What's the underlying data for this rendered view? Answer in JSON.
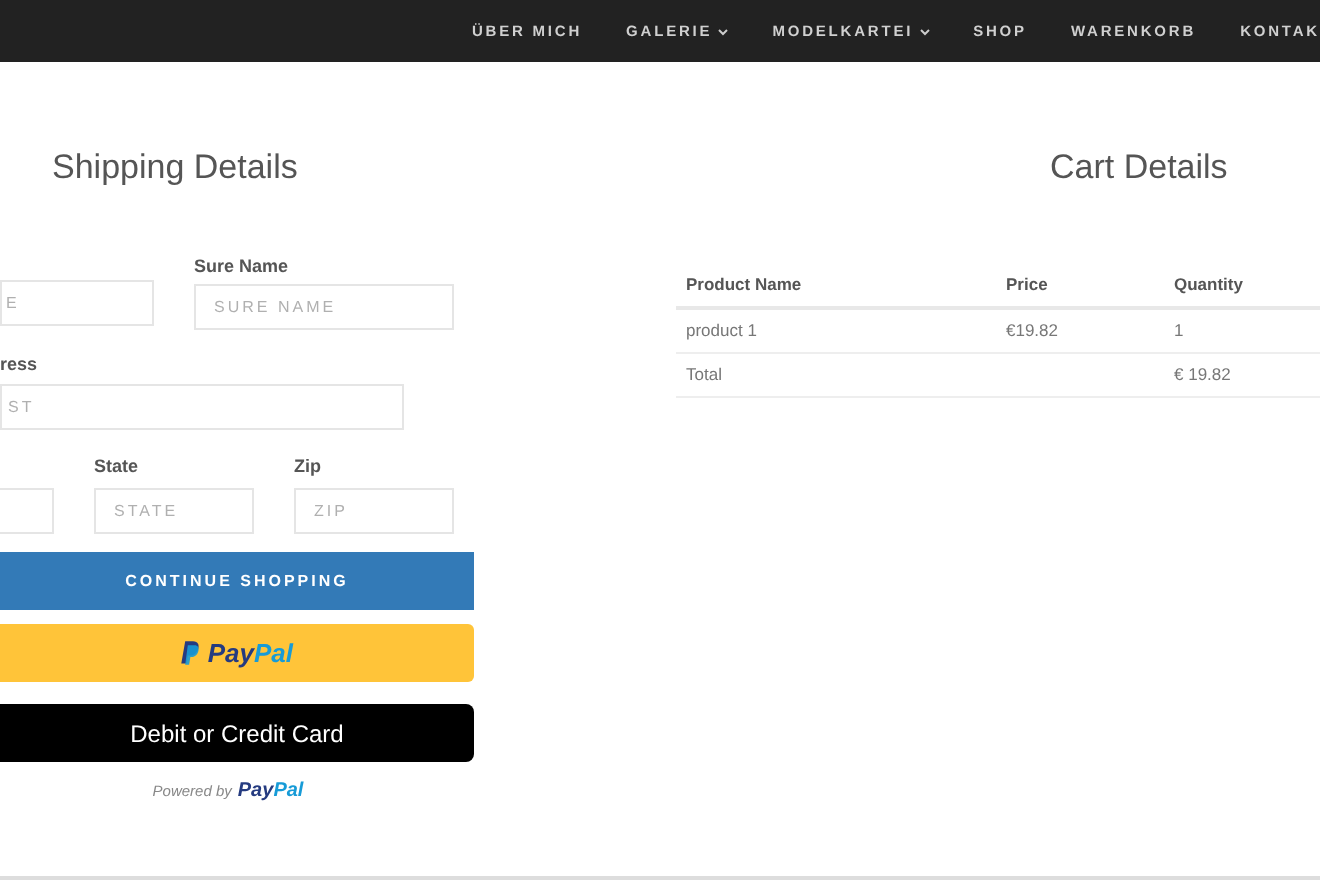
{
  "nav": {
    "items": [
      {
        "label": "ÜBER MICH",
        "dropdown": false
      },
      {
        "label": "GALERIE",
        "dropdown": true
      },
      {
        "label": "MODELKARTEI",
        "dropdown": true
      },
      {
        "label": "SHOP",
        "dropdown": false
      },
      {
        "label": "WARENKORB",
        "dropdown": false
      },
      {
        "label": "KONTAK",
        "dropdown": false
      }
    ]
  },
  "shipping": {
    "title": "Shipping Details",
    "name_row": {
      "first_field": {
        "placeholder": "E"
      },
      "sure_name": {
        "label": "Sure Name",
        "placeholder": "SURE NAME"
      }
    },
    "address": {
      "label": "ress",
      "placeholder": "ST"
    },
    "location_row": {
      "state": {
        "label": "State",
        "placeholder": "STATE"
      },
      "zip": {
        "label": "Zip",
        "placeholder": "ZIP"
      }
    },
    "continue_button": "CONTINUE SHOPPING",
    "paypal_button": "PayPal",
    "card_button": "Debit or Credit Card",
    "powered_by": {
      "prefix": "Powered by",
      "brand": "PayPal"
    }
  },
  "cart": {
    "title": "Cart Details",
    "columns": [
      "Product Name",
      "Price",
      "Quantity"
    ],
    "rows": [
      [
        "product 1",
        "€19.82",
        "1"
      ],
      [
        "Total",
        "",
        "€ 19.82"
      ]
    ]
  }
}
